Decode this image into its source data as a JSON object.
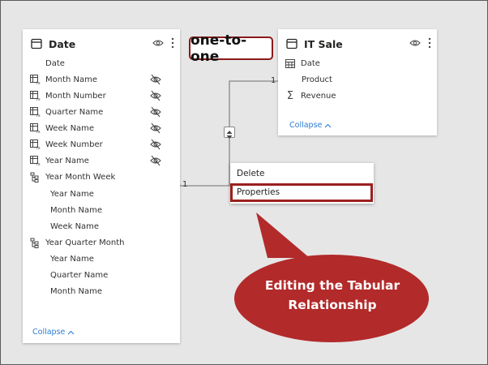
{
  "annotation_label": "one-to-one",
  "callout": {
    "line1": "Editing the Tabular",
    "line2": "Relationship"
  },
  "date_table": {
    "title": "Date",
    "fields": [
      {
        "label": "Date",
        "icon": "none",
        "hidden": false
      },
      {
        "label": "Month Name",
        "icon": "calculated-column-icon",
        "hidden": true
      },
      {
        "label": "Month Number",
        "icon": "calculated-column-icon",
        "hidden": true
      },
      {
        "label": "Quarter Name",
        "icon": "calculated-column-icon",
        "hidden": true
      },
      {
        "label": "Week Name",
        "icon": "calculated-column-icon",
        "hidden": true
      },
      {
        "label": "Week Number",
        "icon": "calculated-column-icon",
        "hidden": true
      },
      {
        "label": "Year Name",
        "icon": "calculated-column-icon",
        "hidden": true
      }
    ],
    "hierarchies": [
      {
        "label": "Year Month Week",
        "levels": [
          "Year Name",
          "Month Name",
          "Week Name"
        ]
      },
      {
        "label": "Year Quarter Month",
        "levels": [
          "Year Name",
          "Quarter Name",
          "Month Name"
        ]
      }
    ],
    "collapse_label": "Collapse"
  },
  "it_sale_table": {
    "title": "IT Sale",
    "fields": [
      {
        "label": "Date",
        "icon": "calendar-icon"
      },
      {
        "label": "Product",
        "icon": "none"
      },
      {
        "label": "Revenue",
        "icon": "sigma-icon"
      }
    ],
    "collapse_label": "Collapse"
  },
  "relationship": {
    "cardinality_left": "1",
    "cardinality_right": "1"
  },
  "context_menu": {
    "items": [
      "Delete",
      "Properties"
    ],
    "highlighted": "Properties"
  },
  "colors": {
    "canvas": "#e6e6e6",
    "accent_red": "#b22a2a",
    "highlight_border": "#9b2020",
    "link_blue": "#2b7cd3"
  }
}
